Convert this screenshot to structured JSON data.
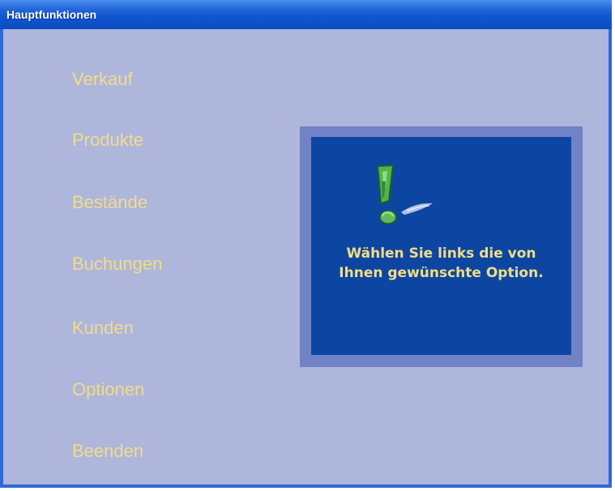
{
  "window": {
    "title": "Hauptfunktionen"
  },
  "menu": {
    "items": [
      {
        "label": "Verkauf"
      },
      {
        "label": "Produkte"
      },
      {
        "label": "Bestände"
      },
      {
        "label": "Buchungen"
      },
      {
        "label": "Kunden"
      },
      {
        "label": "Optionen"
      },
      {
        "label": "Beenden"
      }
    ]
  },
  "message": {
    "line1": "Wählen Sie links die von",
    "line2": "Ihnen gewünschte Option."
  },
  "icons": {
    "alert": "exclamation-icon"
  },
  "colors": {
    "titlebar": "#1f63d8",
    "client_background": "#aeb6dc",
    "menu_text": "#f1dd86",
    "panel_frame": "#7182c7",
    "panel_background": "#0d46a2",
    "message_text": "#f1dd86"
  }
}
